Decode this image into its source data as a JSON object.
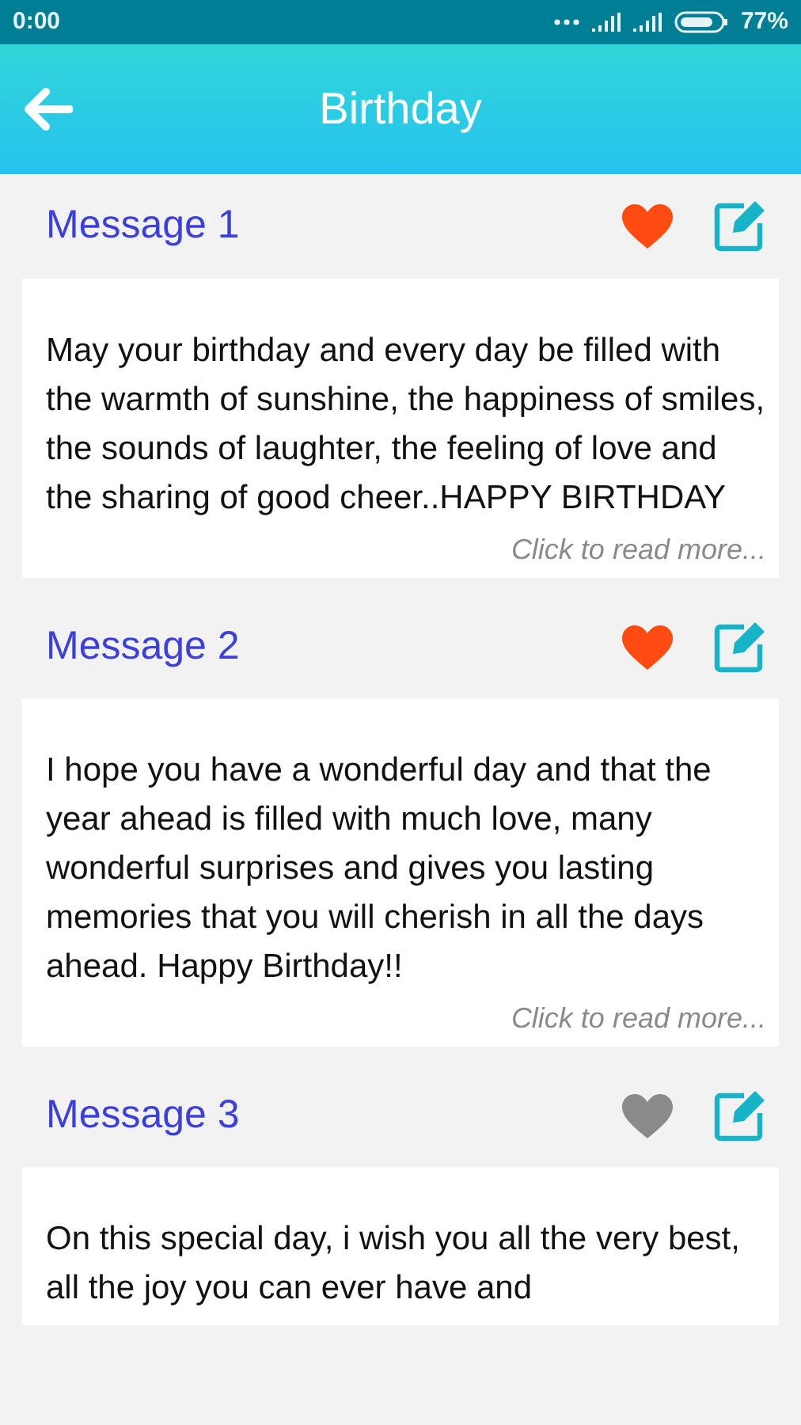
{
  "status_bar": {
    "time": "0:00",
    "battery": "77%"
  },
  "header": {
    "title": "Birthday"
  },
  "messages": [
    {
      "title": "Message 1",
      "favorite": true,
      "text": "May your birthday and every day be filled with the warmth of sunshine, the happiness of smiles, the sounds of laughter, the feeling of love and the sharing of good cheer..HAPPY BIRTHDAY",
      "read_more": "Click to read more..."
    },
    {
      "title": "Message 2",
      "favorite": true,
      "text": "I hope you have a wonderful day and that the year ahead is filled with much love, many wonderful surprises and gives you lasting memories that you will cherish in all the days ahead. Happy Birthday!!",
      "read_more": "Click to read more..."
    },
    {
      "title": "Message 3",
      "favorite": false,
      "text": "On this special day, i wish you all the very best, all the joy you can ever have and"
    }
  ]
}
